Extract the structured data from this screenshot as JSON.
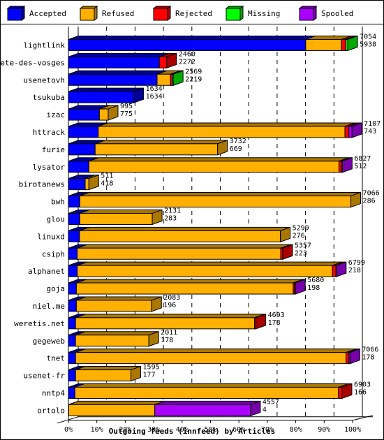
{
  "chart_data": {
    "type": "bar",
    "orientation": "horizontal",
    "stacked": true,
    "style": "3d",
    "xlabel": "Outgoing feeds (innfeed) by Articles",
    "xlim": [
      0,
      100
    ],
    "x_ticks": [
      "0%",
      "10%",
      "20%",
      "30%",
      "40%",
      "50%",
      "60%",
      "70%",
      "80%",
      "90%",
      "100%"
    ],
    "grid": "vertical-dashed",
    "legend_position": "top",
    "legend": [
      {
        "name": "Accepted",
        "color": "#0000ff",
        "dark": "#000099"
      },
      {
        "name": "Refused",
        "color": "#ffb000",
        "dark": "#aa7700"
      },
      {
        "name": "Rejected",
        "color": "#ff0000",
        "dark": "#aa0000"
      },
      {
        "name": "Missing",
        "color": "#00ff00",
        "dark": "#00aa00"
      },
      {
        "name": "Spooled",
        "color": "#aa00ff",
        "dark": "#7700aa"
      }
    ],
    "categories": [
      "lightlink",
      "bete-des-vosges",
      "usenetovh",
      "tsukuba",
      "izac",
      "httrack",
      "furie",
      "lysator",
      "birotanews",
      "bwh",
      "glou",
      "linuxd",
      "csiph",
      "alphanet",
      "goja",
      "niel.me",
      "weretis.net",
      "gegeweb",
      "tnet",
      "usenet-fr",
      "nntp4",
      "ortolo"
    ],
    "labels_top": [
      "7054",
      "2460",
      "2569",
      "1634",
      "995",
      "7107",
      "3732",
      "6827",
      "511",
      "7066",
      "2131",
      "5299",
      "5357",
      "6799",
      "5680",
      "2083",
      "4693",
      "2011",
      "7066",
      "1595",
      "6903",
      "4557"
    ],
    "labels_bottom": [
      "5938",
      "2272",
      "2219",
      "1634",
      "775",
      "743",
      "669",
      "512",
      "418",
      "286",
      "283",
      "276",
      "223",
      "218",
      "198",
      "196",
      "178",
      "178",
      "178",
      "177",
      "166",
      "4"
    ],
    "series": [
      {
        "name": "Accepted",
        "values": [
          83.5,
          32.0,
          31.2,
          23.0,
          10.9,
          10.5,
          9.4,
          7.2,
          5.9,
          4.0,
          4.0,
          3.9,
          3.1,
          3.1,
          2.8,
          2.8,
          2.5,
          2.5,
          2.5,
          2.5,
          2.3,
          0.1
        ]
      },
      {
        "name": "Refused",
        "values": [
          12.6,
          0.0,
          4.7,
          0.0,
          3.1,
          86.8,
          43.1,
          88.0,
          1.3,
          95.4,
          25.5,
          70.7,
          71.6,
          89.8,
          76.3,
          26.5,
          63.0,
          25.8,
          95.2,
          19.5,
          92.7,
          30.3
        ]
      },
      {
        "name": "Rejected",
        "values": [
          1.5,
          2.6,
          0.6,
          0.0,
          0.0,
          1.4,
          0.0,
          0.9,
          0.0,
          0.0,
          0.0,
          0.0,
          0.7,
          1.2,
          0.5,
          0.0,
          0.5,
          0.0,
          1.0,
          0.0,
          1.3,
          0.0
        ]
      },
      {
        "name": "Missing",
        "values": [
          0.7,
          0.0,
          0.4,
          0.0,
          0.0,
          0.0,
          0.0,
          0.0,
          0.0,
          0.0,
          0.0,
          0.0,
          0.0,
          0.0,
          0.0,
          0.0,
          0.0,
          0.0,
          0.0,
          0.0,
          0.0,
          0.0
        ]
      },
      {
        "name": "Spooled",
        "values": [
          0.0,
          0.0,
          0.0,
          0.0,
          0.0,
          1.1,
          0.0,
          0.3,
          0.0,
          0.0,
          0.0,
          0.0,
          0.0,
          0.2,
          0.3,
          0.0,
          0.0,
          0.0,
          0.4,
          0.0,
          0.0,
          33.7
        ]
      }
    ]
  }
}
